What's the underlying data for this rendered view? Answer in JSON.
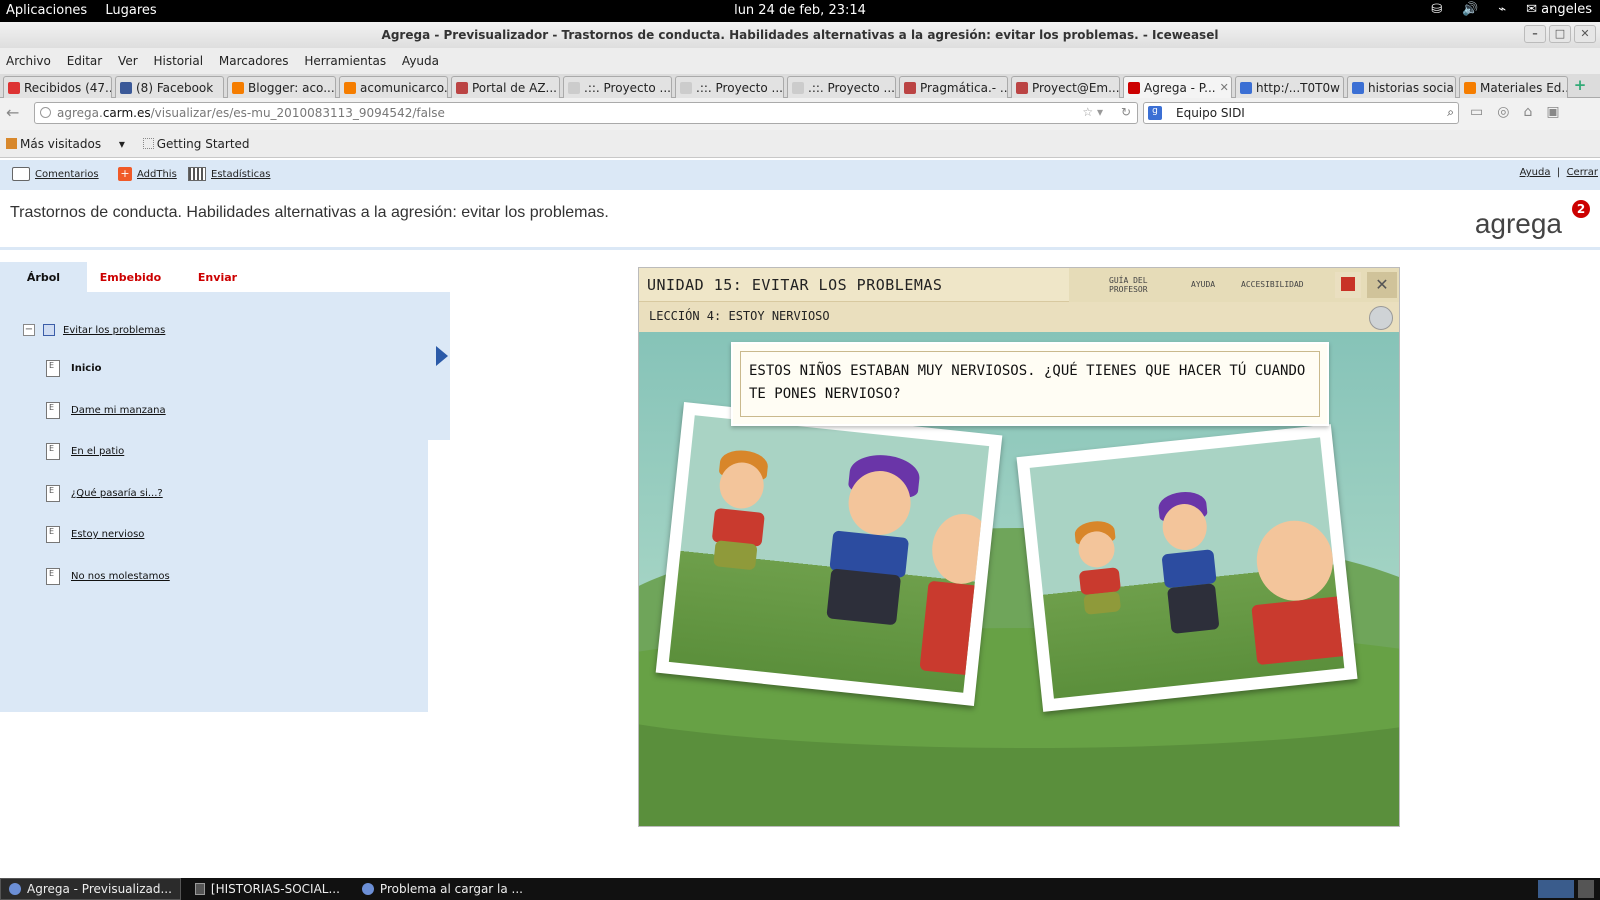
{
  "top_panel": {
    "menu_apps": "Aplicaciones",
    "menu_places": "Lugares",
    "clock": "lun 24 de feb, 23:14",
    "user": "angeles"
  },
  "window": {
    "title": "Agrega - Previsualizador - Trastornos de conducta. Habilidades alternativas a la agresión: evitar los problemas. - Iceweasel"
  },
  "menubar": [
    "Archivo",
    "Editar",
    "Ver",
    "Historial",
    "Marcadores",
    "Herramientas",
    "Ayuda"
  ],
  "tabs": [
    {
      "label": "Recibidos (47...",
      "color": "#d33"
    },
    {
      "label": "(8) Facebook",
      "color": "#3b5998"
    },
    {
      "label": "Blogger: aco...",
      "color": "#f57d00"
    },
    {
      "label": "acomunicarco...",
      "color": "#f57d00"
    },
    {
      "label": "Portal de AZ...",
      "color": "#b44"
    },
    {
      "label": ".::. Proyecto ...",
      "color": "#ccc"
    },
    {
      "label": ".::. Proyecto ...",
      "color": "#ccc"
    },
    {
      "label": ".::. Proyecto ...",
      "color": "#ccc"
    },
    {
      "label": "Pragmática.- ...",
      "color": "#b44"
    },
    {
      "label": "Proyect@Em...",
      "color": "#b44"
    },
    {
      "label": "Agrega - P...",
      "color": "#c00",
      "active": true
    },
    {
      "label": "http:/...T0T0w",
      "color": "#3b6fd4"
    },
    {
      "label": "historias socia...",
      "color": "#3b6fd4"
    },
    {
      "label": "Materiales Ed...",
      "color": "#f57d00"
    }
  ],
  "navbar": {
    "url_prefix": "agrega.",
    "url_host": "carm.es",
    "url_path": "/visualizar/es/es-mu_2010083113_9094542/false",
    "search_value": "Equipo SIDI"
  },
  "bookmarks": {
    "most_visited": "Más visitados",
    "getting_started": "Getting Started"
  },
  "page_tools": {
    "comments": "Comentarios",
    "addthis": "AddThis",
    "stats": "Estadísticas",
    "help": "Ayuda",
    "close": "Cerrar"
  },
  "page": {
    "title": "Trastornos de conducta. Habilidades alternativas a la agresión: evitar los problemas.",
    "logo": "agrega",
    "logo_badge": "2"
  },
  "side_tabs": [
    "Árbol",
    "Embebido",
    "Enviar"
  ],
  "tree": {
    "root": "Evitar los problemas",
    "items": [
      {
        "label": "Inicio",
        "current": true
      },
      {
        "label": "Dame mi manzana"
      },
      {
        "label": "En el patio"
      },
      {
        "label": "¿Qué pasaría si...?"
      },
      {
        "label": "Estoy nervioso"
      },
      {
        "label": "No nos molestamos"
      }
    ]
  },
  "viewer": {
    "unit_title": "UNIDAD 15: EVITAR LOS PROBLEMAS",
    "nav_guide_line1": "GUÍA DEL",
    "nav_guide_line2": "PROFESOR",
    "nav_help": "AYUDA",
    "nav_accessibility": "ACCESIBILIDAD",
    "lesson_title": "LECCIÓN 4: ESTOY NERVIOSO",
    "question": "ESTOS NIÑOS ESTABAN MUY NERVIOSOS. ¿QUÉ TIENES QUE HACER TÚ CUANDO TE PONES NERVIOSO?"
  },
  "taskbar": [
    {
      "label": "Agrega - Previsualizad...",
      "active": true
    },
    {
      "label": "[HISTORIAS-SOCIAL..."
    },
    {
      "label": "Problema al cargar la ..."
    }
  ]
}
